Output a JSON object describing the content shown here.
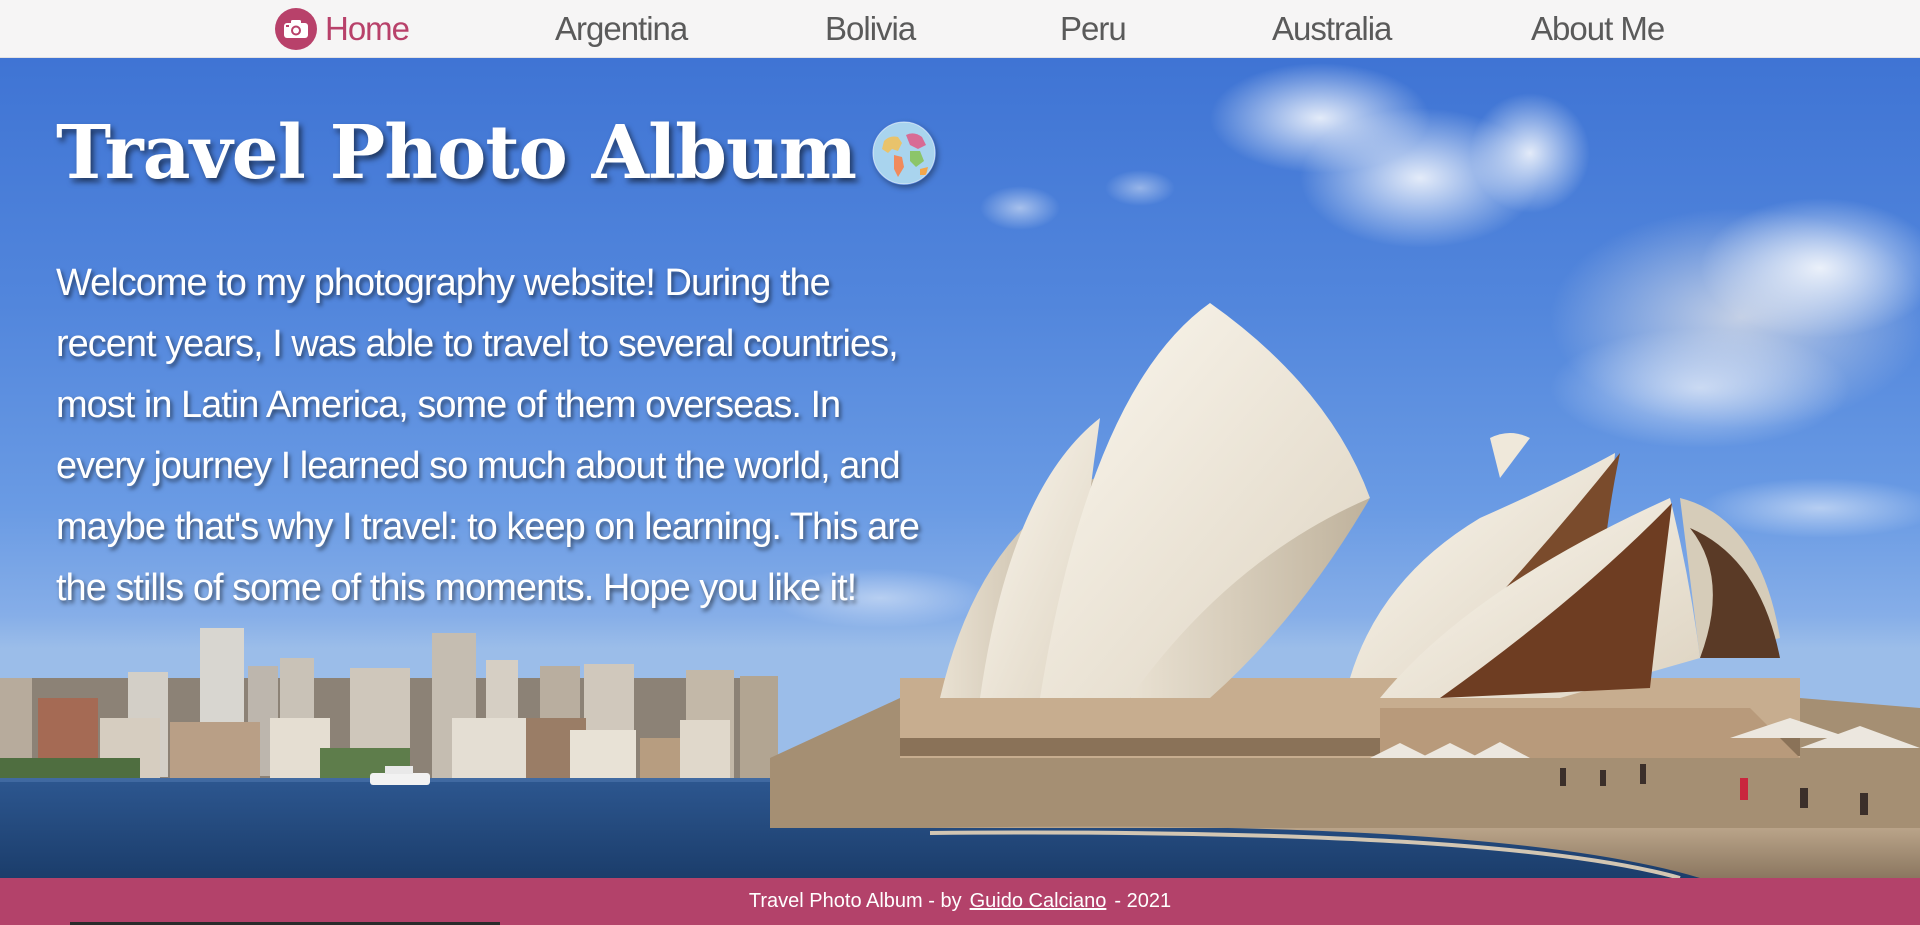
{
  "nav": {
    "items": [
      {
        "label": "Home",
        "icon": "camera-icon",
        "active": true
      },
      {
        "label": "Argentina"
      },
      {
        "label": "Bolivia"
      },
      {
        "label": "Peru"
      },
      {
        "label": "Australia"
      },
      {
        "label": "About Me"
      }
    ]
  },
  "hero": {
    "title": "Travel Photo Album",
    "title_icon": "globe-icon",
    "intro": "Welcome to my photography website! During the recent years, I was able to travel to several countries, most in Latin America, some of them overseas. In every journey I learned so much about the world, and maybe that's why I travel: to keep on learning. This are the stills of some of this moments. Hope you like it!",
    "background_image": "sydney-opera-house-photo"
  },
  "footer": {
    "text_before": "Travel Photo Album  - by",
    "author": "Guido Calciano",
    "text_after": "-  2021"
  },
  "colors": {
    "accent": "#b8416a",
    "footer_bg": "#b3426a",
    "nav_bg": "#f6f5f5",
    "nav_text": "#5a5a5a"
  }
}
